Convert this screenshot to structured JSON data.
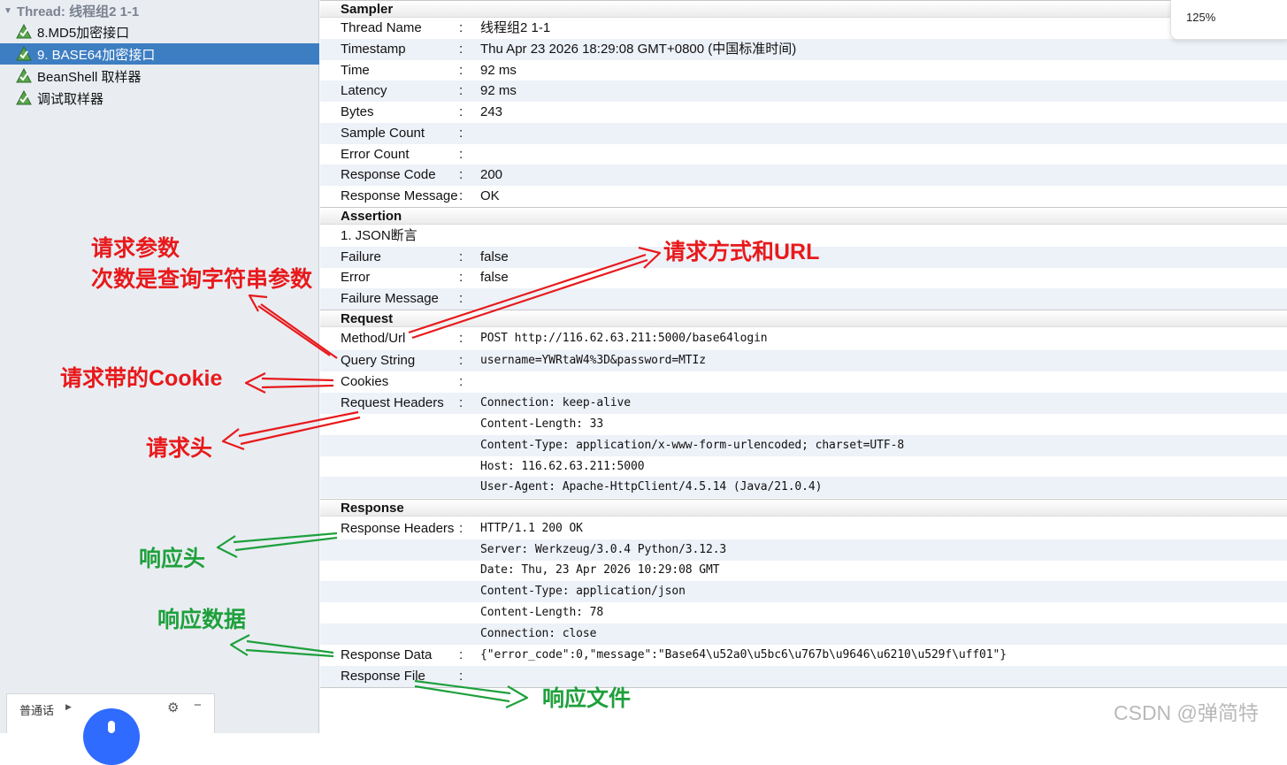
{
  "tree": {
    "root": "Thread: 线程组2 1-1",
    "items": [
      {
        "label": "8.MD5加密接口",
        "selected": false
      },
      {
        "label": "9. BASE64加密接口",
        "selected": true
      },
      {
        "label": "BeanShell 取样器",
        "selected": false
      },
      {
        "label": "调试取样器",
        "selected": false
      }
    ]
  },
  "ime": {
    "label": "普通话"
  },
  "zoom": {
    "level": "125%"
  },
  "sampler": {
    "title": "Sampler",
    "rows": [
      {
        "k": "Thread Name",
        "v": "线程组2 1-1"
      },
      {
        "k": "Timestamp",
        "v": "Thu Apr 23 2026 18:29:08 GMT+0800 (中国标准时间)"
      },
      {
        "k": "Time",
        "v": "92 ms"
      },
      {
        "k": "Latency",
        "v": "92 ms"
      },
      {
        "k": "Bytes",
        "v": "243"
      },
      {
        "k": "Sample Count",
        "v": ""
      },
      {
        "k": "Error Count",
        "v": ""
      },
      {
        "k": "Response Code",
        "v": "200"
      },
      {
        "k": "Response Message",
        "v": "OK"
      }
    ]
  },
  "assertion": {
    "title": "Assertion",
    "name": "1. JSON断言",
    "rows": [
      {
        "k": "Failure",
        "v": "false"
      },
      {
        "k": "Error",
        "v": "false"
      },
      {
        "k": "Failure Message",
        "v": ""
      }
    ]
  },
  "request": {
    "title": "Request",
    "rows": [
      {
        "k": "Method/Url",
        "v": "POST http://116.62.63.211:5000/base64login"
      },
      {
        "k": "Query String",
        "v": "username=YWRtaW4%3D&password=MTIz"
      },
      {
        "k": "Cookies",
        "v": ""
      },
      {
        "k": "Request Headers",
        "v": "Connection: keep-alive"
      },
      {
        "k": "",
        "v": "Content-Length: 33"
      },
      {
        "k": "",
        "v": "Content-Type: application/x-www-form-urlencoded; charset=UTF-8"
      },
      {
        "k": "",
        "v": "Host: 116.62.63.211:5000"
      },
      {
        "k": "",
        "v": "User-Agent: Apache-HttpClient/4.5.14 (Java/21.0.4)"
      }
    ]
  },
  "response": {
    "title": "Response",
    "rows": [
      {
        "k": "Response Headers",
        "v": "HTTP/1.1 200 OK"
      },
      {
        "k": "",
        "v": "Server: Werkzeug/3.0.4 Python/3.12.3"
      },
      {
        "k": "",
        "v": "Date: Thu, 23 Apr 2026 10:29:08 GMT"
      },
      {
        "k": "",
        "v": "Content-Type: application/json"
      },
      {
        "k": "",
        "v": "Content-Length: 78"
      },
      {
        "k": "",
        "v": "Connection: close"
      },
      {
        "k": "Response Data",
        "v": "{\"error_code\":0,\"message\":\"Base64\\u52a0\\u5bc6\\u767b\\u9646\\u6210\\u529f\\uff01\"}"
      },
      {
        "k": "Response File",
        "v": ""
      }
    ]
  },
  "annotations": {
    "params_1": "请求参数",
    "params_2": "次数是查询字符串参数",
    "method_url": "请求方式和URL",
    "cookie": "请求带的Cookie",
    "req_header": "请求头",
    "resp_header": "响应头",
    "resp_data": "响应数据",
    "resp_file": "响应文件"
  },
  "colors": {
    "red": "#e8191b",
    "green": "#1ea03c",
    "selected": "#3d7ec2"
  },
  "watermark": "CSDN @弹简特"
}
